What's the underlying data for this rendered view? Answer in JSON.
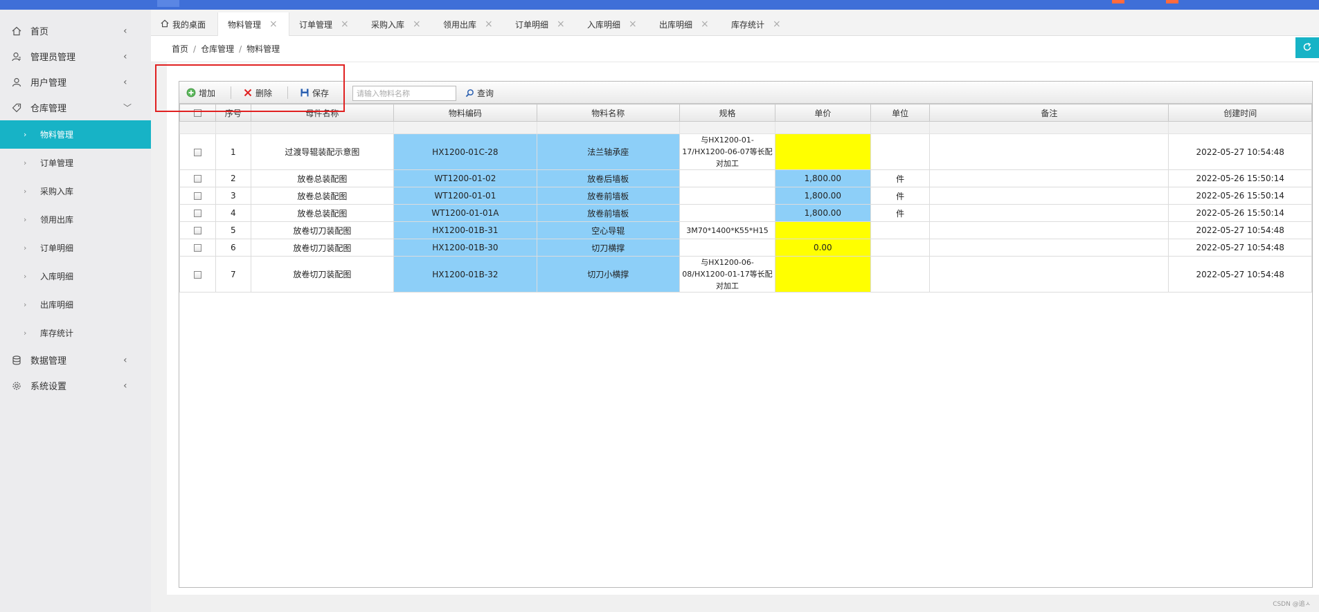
{
  "sidebar": {
    "items": [
      {
        "label": "首页",
        "icon": "home-icon"
      },
      {
        "label": "管理员管理",
        "icon": "admin-user-icon"
      },
      {
        "label": "用户管理",
        "icon": "user-icon"
      },
      {
        "label": "仓库管理",
        "icon": "tag-icon"
      },
      {
        "label": "数据管理",
        "icon": "database-icon"
      },
      {
        "label": "系统设置",
        "icon": "gear-icon"
      }
    ],
    "sub_items": [
      "物料管理",
      "订单管理",
      "采购入库",
      "领用出库",
      "订单明细",
      "入库明细",
      "出库明细",
      "库存统计"
    ],
    "active_sub": "物料管理"
  },
  "tabs": [
    {
      "label": "我的桌面"
    },
    {
      "label": "物料管理"
    },
    {
      "label": "订单管理"
    },
    {
      "label": "采购入库"
    },
    {
      "label": "领用出库"
    },
    {
      "label": "订单明细"
    },
    {
      "label": "入库明细"
    },
    {
      "label": "出库明细"
    },
    {
      "label": "库存统计"
    }
  ],
  "breadcrumb": [
    "首页",
    "仓库管理",
    "物料管理"
  ],
  "breadcrumb_sep": "/",
  "toolbar": {
    "add_label": "增加",
    "delete_label": "删除",
    "save_label": "保存",
    "search_placeholder": "请输入物料名称",
    "query_label": "查询"
  },
  "table": {
    "columns": [
      "序号",
      "母件名称",
      "物料编码",
      "物料名称",
      "规格",
      "单价",
      "单位",
      "备注",
      "创建时间"
    ],
    "rows": [
      {
        "no": "1",
        "parent": "过渡导辊装配示意图",
        "code": "HX1200-01C-28",
        "name": "法兰轴承座",
        "spec": "与HX1200-01-17/HX1200-06-07等长配对加工",
        "price": "",
        "unit": "",
        "remark": "",
        "created": "2022-05-27 10:54:48",
        "price_color": "yellow"
      },
      {
        "no": "2",
        "parent": "放卷总装配图",
        "code": "WT1200-01-02",
        "name": "放卷后墙板",
        "spec": "",
        "price": "1,800.00",
        "unit": "件",
        "remark": "",
        "created": "2022-05-26 15:50:14",
        "price_color": "blue"
      },
      {
        "no": "3",
        "parent": "放卷总装配图",
        "code": "WT1200-01-01",
        "name": "放卷前墙板",
        "spec": "",
        "price": "1,800.00",
        "unit": "件",
        "remark": "",
        "created": "2022-05-26 15:50:14",
        "price_color": "blue"
      },
      {
        "no": "4",
        "parent": "放卷总装配图",
        "code": "WT1200-01-01A",
        "name": "放卷前墙板",
        "spec": "",
        "price": "1,800.00",
        "unit": "件",
        "remark": "",
        "created": "2022-05-26 15:50:14",
        "price_color": "blue"
      },
      {
        "no": "5",
        "parent": "放卷切刀装配图",
        "code": "HX1200-01B-31",
        "name": "空心导辊",
        "spec": "3M70*1400*K55*H15",
        "price": "",
        "unit": "",
        "remark": "",
        "created": "2022-05-27 10:54:48",
        "price_color": "yellow"
      },
      {
        "no": "6",
        "parent": "放卷切刀装配图",
        "code": "HX1200-01B-30",
        "name": "切刀横撑",
        "spec": "",
        "price": "0.00",
        "unit": "",
        "remark": "",
        "created": "2022-05-27 10:54:48",
        "price_color": "yellow"
      },
      {
        "no": "7",
        "parent": "放卷切刀装配图",
        "code": "HX1200-01B-32",
        "name": "切刀小横撑",
        "spec": "与HX1200-06-08/HX1200-01-17等长配对加工",
        "price": "",
        "unit": "",
        "remark": "",
        "created": "2022-05-27 10:54:48",
        "price_color": "yellow"
      }
    ]
  },
  "colors": {
    "accent": "#17b3c6",
    "topbar": "#3f6fd8",
    "cell_blue": "#8dcff8",
    "cell_yellow": "#ffff00",
    "highlight_red": "#e02020"
  },
  "watermark": "CSDN @追ㅅ"
}
